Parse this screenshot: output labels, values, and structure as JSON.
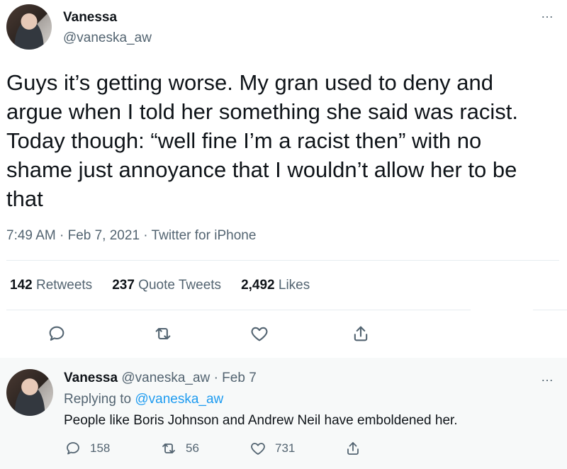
{
  "main_tweet": {
    "author": {
      "name": "Vanessa",
      "handle": "@vaneska_aw"
    },
    "text": "Guys it’s getting worse. My gran used to deny and argue when I told her something she said was racist. Today though: “well fine I’m a racist then” with no shame just annoyance that I wouldn’t allow her to be that",
    "meta": "7:49 AM · Feb 7, 2021 · Twitter for iPhone",
    "stats": [
      {
        "count": "142",
        "label": "Retweets"
      },
      {
        "count": "237",
        "label": "Quote Tweets"
      },
      {
        "count": "2,492",
        "label": "Likes"
      }
    ],
    "more_icon": "…",
    "action_icons": [
      "reply-icon",
      "retweet-icon",
      "like-icon",
      "share-icon"
    ]
  },
  "reply_tweet": {
    "author": {
      "name": "Vanessa",
      "handle": "@vaneska_aw"
    },
    "separator": "·",
    "date": "Feb 7",
    "replying_label": "Replying to",
    "replying_to": "@vaneska_aw",
    "text": "People like Boris Johnson and Andrew Neil have emboldened her.",
    "more_icon": "…",
    "actions": {
      "replies": "158",
      "retweets": "56",
      "likes": "731"
    }
  },
  "colors": {
    "text": "#0f1419",
    "secondary": "#536471",
    "link": "#1d9bf0",
    "divider": "#e6ecf0",
    "reply_bg": "#f7f9f9"
  }
}
